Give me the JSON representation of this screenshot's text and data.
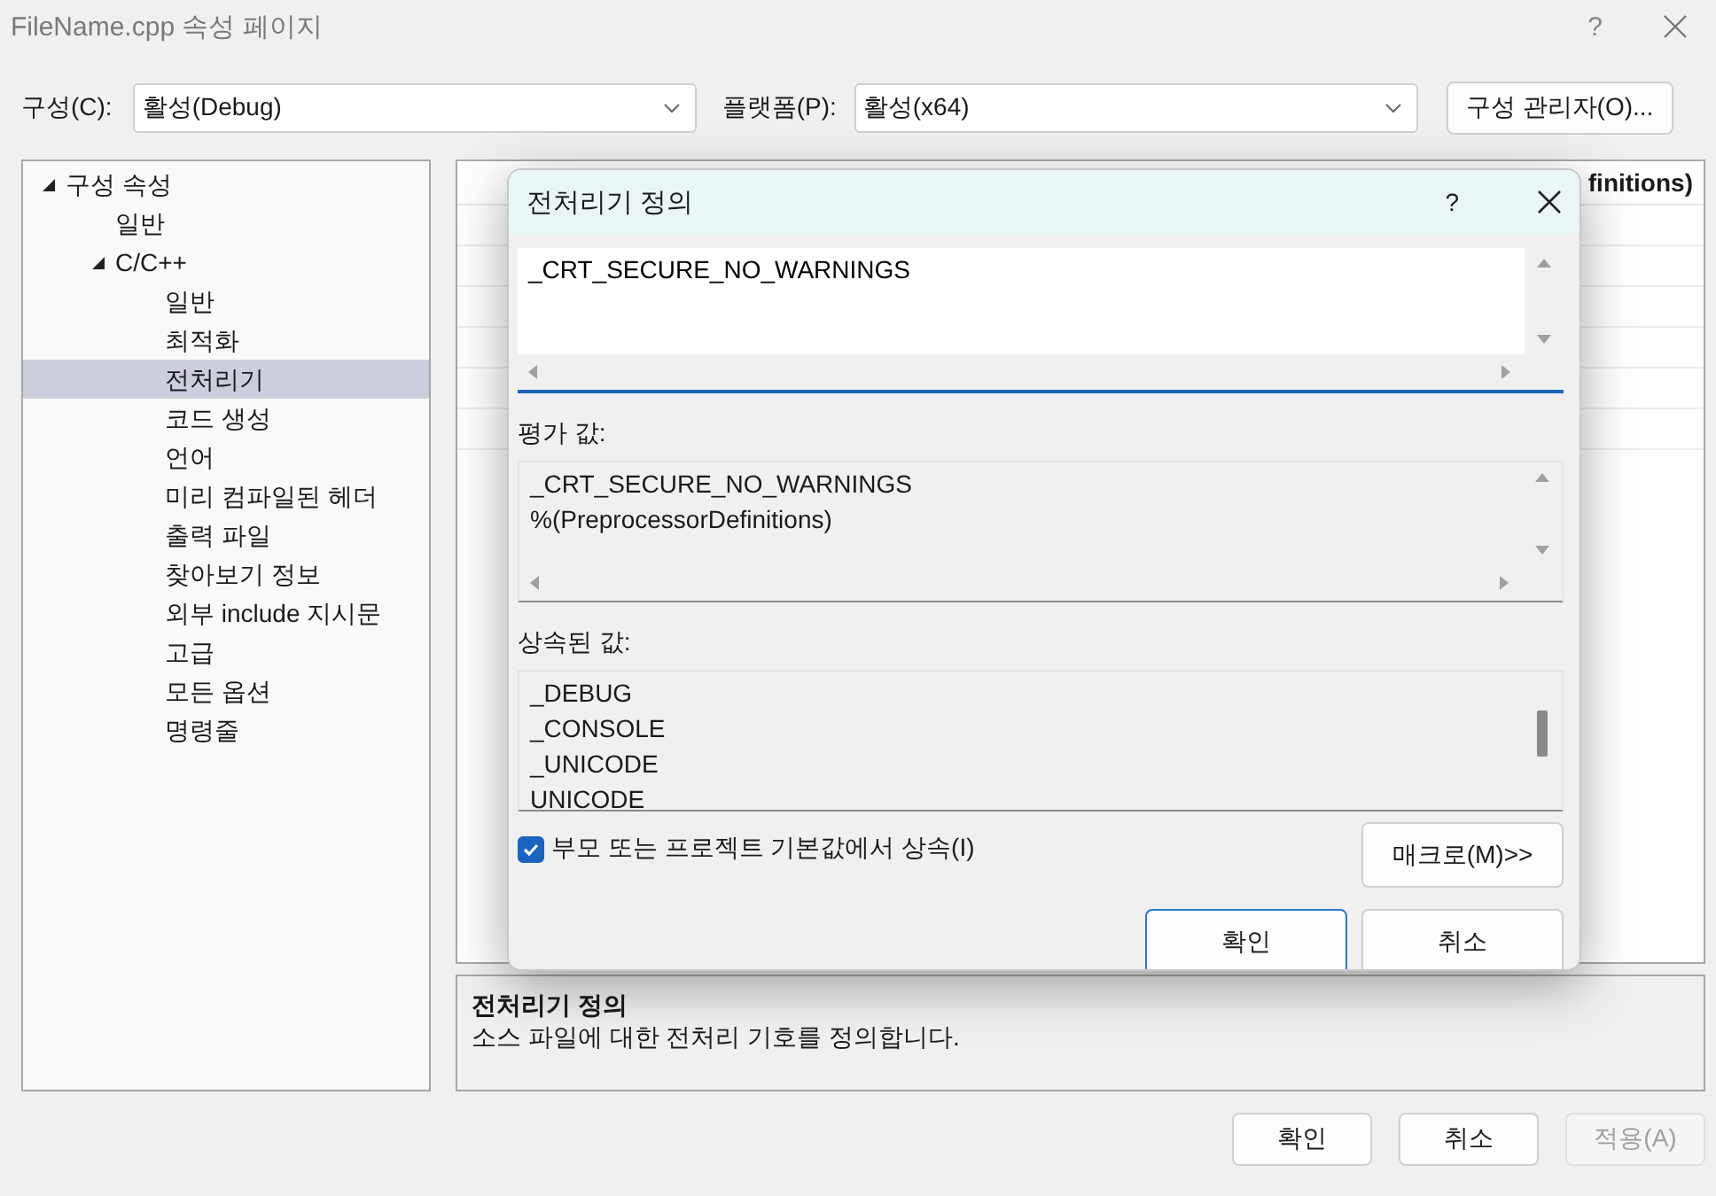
{
  "window": {
    "title": "FileName.cpp 속성 페이지",
    "help": "?"
  },
  "toolbar": {
    "configuration_label": "구성(C):",
    "configuration": "활성(Debug)",
    "platform_label": "플랫폼(P):",
    "platform": "활성(x64)",
    "manager_button": "구성 관리자(O)..."
  },
  "tree": [
    {
      "label": "구성 속성",
      "expanded": true,
      "selected": false,
      "children": [
        {
          "label": "일반",
          "selected": false
        },
        {
          "label": "C/C++",
          "expanded": true,
          "selected": false,
          "children": [
            {
              "label": "일반",
              "selected": false
            },
            {
              "label": "최적화",
              "selected": false
            },
            {
              "label": "전처리기",
              "selected": true
            },
            {
              "label": "코드 생성",
              "selected": false
            },
            {
              "label": "언어",
              "selected": false
            },
            {
              "label": "미리 컴파일된 헤더",
              "selected": false
            },
            {
              "label": "출력 파일",
              "selected": false
            },
            {
              "label": "찾아보기 정보",
              "selected": false
            },
            {
              "label": "외부 include 지시문",
              "selected": false
            },
            {
              "label": "고급",
              "selected": false
            },
            {
              "label": "모든 옵션",
              "selected": false
            },
            {
              "label": "명령줄",
              "selected": false
            }
          ]
        }
      ]
    }
  ],
  "grid": {
    "header_text": "finitions)"
  },
  "description": {
    "title": "전처리기 정의",
    "text": "소스 파일에 대한 전처리 기호를 정의합니다."
  },
  "buttons": [
    {
      "label": "확인",
      "disabled": false
    },
    {
      "label": "취소",
      "disabled": false
    },
    {
      "label": "적용(A)",
      "disabled": true
    }
  ],
  "dialog": {
    "title": "전처리기 정의",
    "help": "?",
    "value": "_CRT_SECURE_NO_WARNINGS",
    "evaluated_label": "평가 값:",
    "evaluated": [
      "_CRT_SECURE_NO_WARNINGS",
      "%(PreprocessorDefinitions)"
    ],
    "inherited_label": "상속된 값:",
    "inherited": [
      "_DEBUG",
      "_CONSOLE",
      "_UNICODE",
      "UNICODE"
    ],
    "inherit_checkbox": {
      "label": "부모 또는 프로젝트 기본값에서 상속(I)",
      "checked": true
    },
    "macros_button": "매크로(M)>>",
    "buttons": [
      {
        "label": "확인",
        "default": true
      },
      {
        "label": "취소",
        "default": false
      }
    ]
  }
}
